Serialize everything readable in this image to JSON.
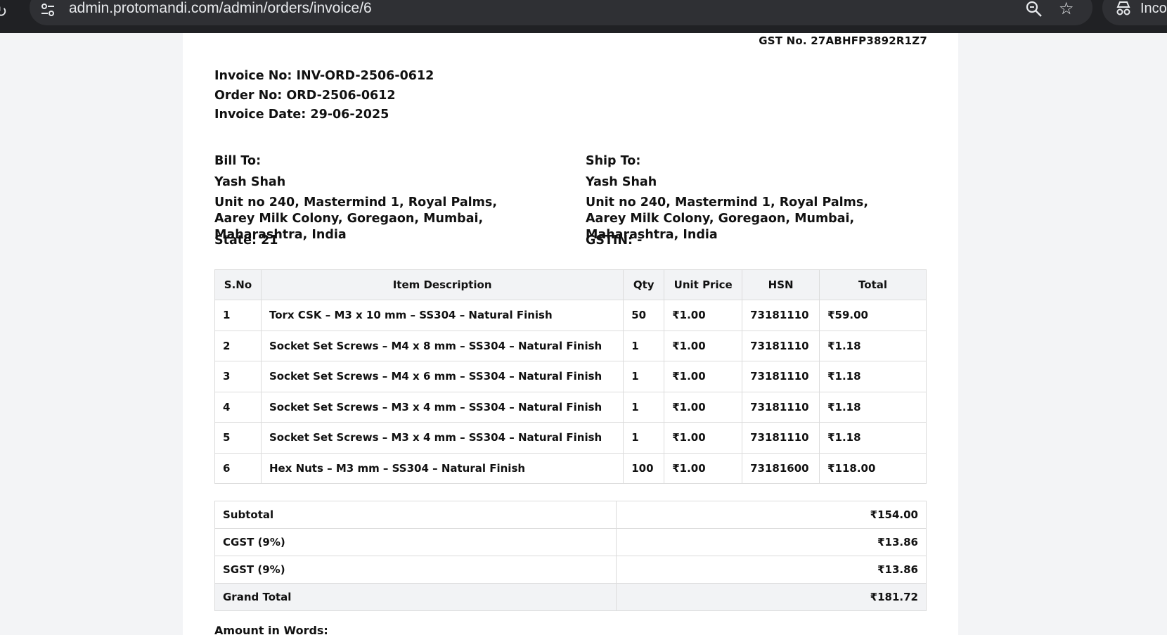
{
  "browser": {
    "url": "admin.protomandi.com/admin/orders/invoice/6",
    "incognito_label": "Inco"
  },
  "invoice": {
    "gst_no": "GST No. 27ABHFP3892R1Z7",
    "invoice_no": "Invoice No: INV-ORD-2506-0612",
    "order_no": "Order No: ORD-2506-0612",
    "invoice_date": "Invoice Date: 29-06-2025"
  },
  "bill_to": {
    "heading": "Bill To:",
    "name": "Yash Shah",
    "address": "Unit no 240, Mastermind 1, Royal Palms, Aarey Milk Colony, Goregaon, Mumbai, Maharashtra, India",
    "extra": "State: 21"
  },
  "ship_to": {
    "heading": "Ship To:",
    "name": "Yash Shah",
    "address": "Unit no 240, Mastermind 1, Royal Palms, Aarey Milk Colony, Goregaon, Mumbai, Maharashtra, India",
    "extra": "GSTIN: -"
  },
  "items_table": {
    "headers": [
      "S.No",
      "Item Description",
      "Qty",
      "Unit Price",
      "HSN",
      "Total"
    ],
    "rows": [
      [
        "1",
        "Torx CSK – M3 x 10 mm – SS304 – Natural Finish",
        "50",
        "₹1.00",
        "73181110",
        "₹59.00"
      ],
      [
        "2",
        "Socket Set Screws – M4 x 8 mm – SS304 – Natural Finish",
        "1",
        "₹1.00",
        "73181110",
        "₹1.18"
      ],
      [
        "3",
        "Socket Set Screws – M4 x 6 mm – SS304 – Natural Finish",
        "1",
        "₹1.00",
        "73181110",
        "₹1.18"
      ],
      [
        "4",
        "Socket Set Screws – M3 x 4 mm – SS304 – Natural Finish",
        "1",
        "₹1.00",
        "73181110",
        "₹1.18"
      ],
      [
        "5",
        "Socket Set Screws – M3 x 4 mm – SS304 – Natural Finish",
        "1",
        "₹1.00",
        "73181110",
        "₹1.18"
      ],
      [
        "6",
        "Hex Nuts – M3 mm – SS304 – Natural Finish",
        "100",
        "₹1.00",
        "73181600",
        "₹118.00"
      ]
    ]
  },
  "totals": {
    "subtotal_label": "Subtotal",
    "subtotal": "₹154.00",
    "cgst_label": "CGST (9%)",
    "cgst": "₹13.86",
    "sgst_label": "SGST (9%)",
    "sgst": "₹13.86",
    "grand_label": "Grand Total",
    "grand": "₹181.72"
  },
  "amount_in_words_label": "Amount in Words:",
  "colors": {
    "chrome": "#202124",
    "omnibox": "#2f3034",
    "table_header": "#f2f3f5",
    "border": "#dcdcdc"
  }
}
